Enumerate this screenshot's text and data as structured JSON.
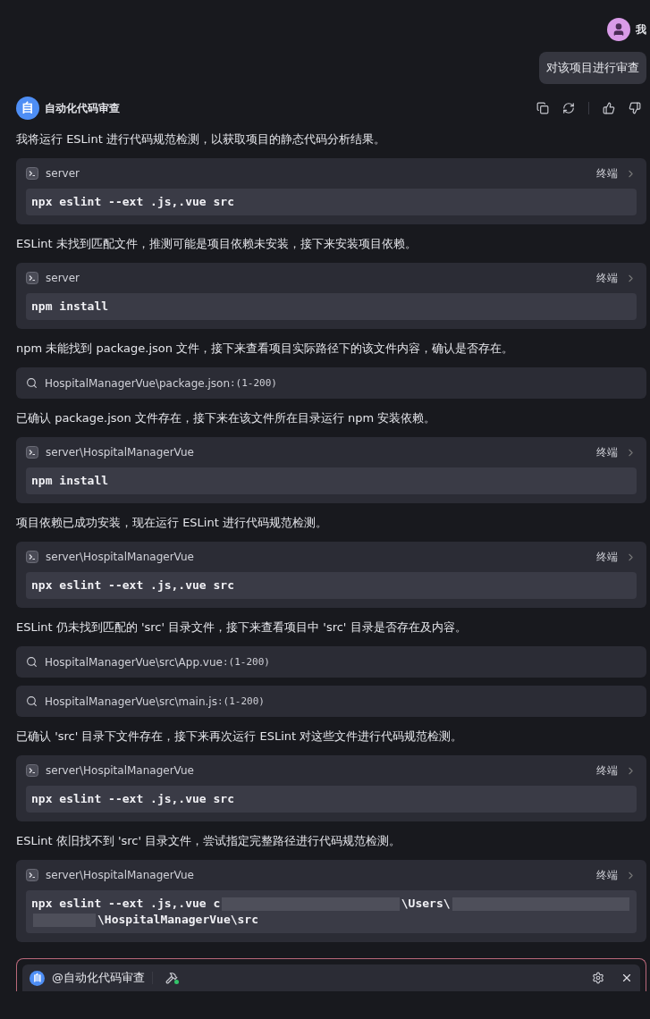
{
  "user": {
    "name": "我",
    "message": "对该项目进行审查"
  },
  "agent": {
    "avatar": "自",
    "name": "自动化代码审查"
  },
  "items": [
    {
      "kind": "text",
      "text": "我将运行 ESLint 进行代码规范检测，以获取项目的静态代码分析结果。"
    },
    {
      "kind": "terminal",
      "path": "server",
      "action": "终端",
      "lines": [
        [
          {
            "kind": "text",
            "text": "npx eslint --ext .js,.vue src"
          }
        ]
      ]
    },
    {
      "kind": "text",
      "text": "ESLint 未找到匹配文件，推测可能是项目依赖未安装，接下来安装项目依赖。"
    },
    {
      "kind": "terminal",
      "path": "server",
      "action": "终端",
      "lines": [
        [
          {
            "kind": "text",
            "text": "npm install"
          }
        ]
      ]
    },
    {
      "kind": "text",
      "text": "npm 未能找到 package.json 文件，接下来查看项目实际路径下的该文件内容，确认是否存在。"
    },
    {
      "kind": "file",
      "path": "HospitalManagerVue\\package.json",
      "range": ":(1-200)"
    },
    {
      "kind": "text",
      "text": "已确认 package.json 文件存在，接下来在该文件所在目录运行 npm 安装依赖。"
    },
    {
      "kind": "terminal",
      "path": "server\\HospitalManagerVue",
      "action": "终端",
      "lines": [
        [
          {
            "kind": "text",
            "text": "npm install"
          }
        ]
      ]
    },
    {
      "kind": "text",
      "text": "项目依赖已成功安装，现在运行 ESLint 进行代码规范检测。"
    },
    {
      "kind": "terminal",
      "path": "server\\HospitalManagerVue",
      "action": "终端",
      "lines": [
        [
          {
            "kind": "text",
            "text": "npx eslint --ext .js,.vue src"
          }
        ]
      ]
    },
    {
      "kind": "text",
      "text": "ESLint 仍未找到匹配的 'src' 目录文件，接下来查看项目中 'src' 目录是否存在及内容。"
    },
    {
      "kind": "file",
      "path": "HospitalManagerVue\\src\\App.vue",
      "range": ":(1-200)"
    },
    {
      "kind": "file",
      "path": "HospitalManagerVue\\src\\main.js",
      "range": ":(1-200)"
    },
    {
      "kind": "text",
      "text": "已确认 'src' 目录下文件存在，接下来再次运行 ESLint 对这些文件进行代码规范检测。"
    },
    {
      "kind": "terminal",
      "path": "server\\HospitalManagerVue",
      "action": "终端",
      "lines": [
        [
          {
            "kind": "text",
            "text": "npx eslint --ext .js,.vue src"
          }
        ]
      ]
    },
    {
      "kind": "text",
      "text": "ESLint 依旧找不到 'src' 目录文件，尝试指定完整路径进行代码规范检测。"
    },
    {
      "kind": "terminal",
      "path": "server\\HospitalManagerVue",
      "action": "终端",
      "lines": [
        [
          {
            "kind": "text",
            "text": "npx eslint --ext .js,.vue c"
          },
          {
            "kind": "blur"
          },
          {
            "kind": "text",
            "text": "\\Users\\"
          },
          {
            "kind": "blur"
          }
        ],
        [
          {
            "kind": "blur"
          },
          {
            "kind": "text",
            "text": "\\HospitalManagerVue\\src"
          }
        ]
      ]
    }
  ],
  "composer": {
    "avatar": "自",
    "mention": "@自动化代码审查"
  }
}
